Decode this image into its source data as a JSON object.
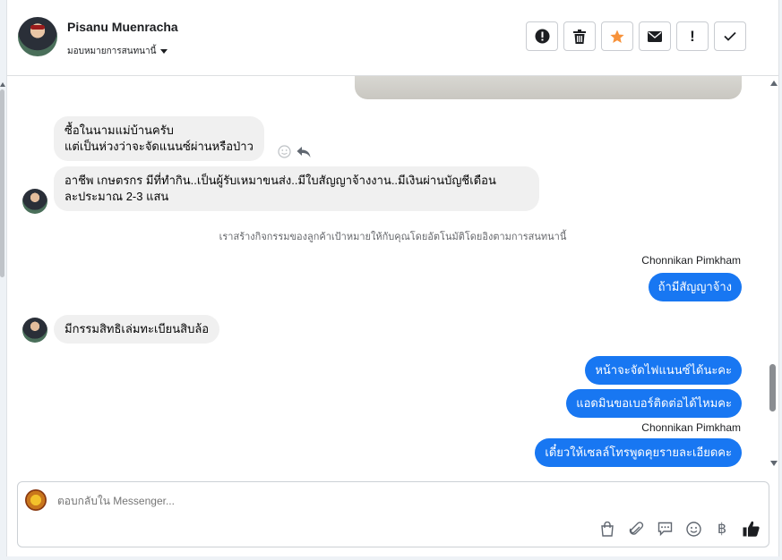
{
  "header": {
    "contact_name": "Pisanu Muenracha",
    "assign_label": "มอบหมายการสนทนานี้",
    "actions": [
      {
        "name": "spam-report-icon",
        "label": "!"
      },
      {
        "name": "trash-icon",
        "label": ""
      },
      {
        "name": "star-icon",
        "label": "★"
      },
      {
        "name": "envelope-icon",
        "label": ""
      },
      {
        "name": "exclamation-icon",
        "label": "!"
      },
      {
        "name": "checkmark-icon",
        "label": "✓"
      }
    ]
  },
  "messages": {
    "m1_line1": "ซื้อในนามแม่บ้านครับ",
    "m1_line2": "แต่เป็นห่วงว่าจะจัดแนนซ์ผ่านหรือป่าว",
    "m2_line1": "อาชีพ เกษตรกร มีที่ทำกิน..เป็นผู้รับเหมาขนส่ง..มีใบสัญญาจ้างงาน..มีเงินผ่านบัญชีเดือน",
    "m2_line2": "ละประมาณ 2-3 แสน",
    "system_note": "เราสร้างกิจกรรมของลูกค้าเป้าหมายให้กับคุณโดยอัตโนมัติโดยอิงตามการสนทนานี้",
    "sender1": "Chonnikan Pimkham",
    "m3": "ถ้ามีสัญญาจ้าง",
    "m4": "มีกรรมสิทธิเล่มทะเบียนสิบล้อ",
    "m5": "หน้าจะจัดไฟแนนซ์ได้นะคะ",
    "m6": "แอดมินขอเบอร์ติดต่อได้ไหมคะ",
    "sender2": "Chonnikan Pimkham",
    "m7": "เดี๋ยวให้เซลล์โทรพูดคุยรายละเอียดคะ"
  },
  "composer": {
    "placeholder": "ตอบกลับใน Messenger...",
    "tools": [
      "shopping-bag-icon",
      "paperclip-icon",
      "saved-reply-icon",
      "emoji-icon",
      "baht-icon",
      "thumbs-up-icon"
    ],
    "baht_symbol": "฿"
  },
  "colors": {
    "outgoing_bubble": "#1877f2",
    "incoming_bubble": "#f0f0f0",
    "star": "#f7923a"
  }
}
